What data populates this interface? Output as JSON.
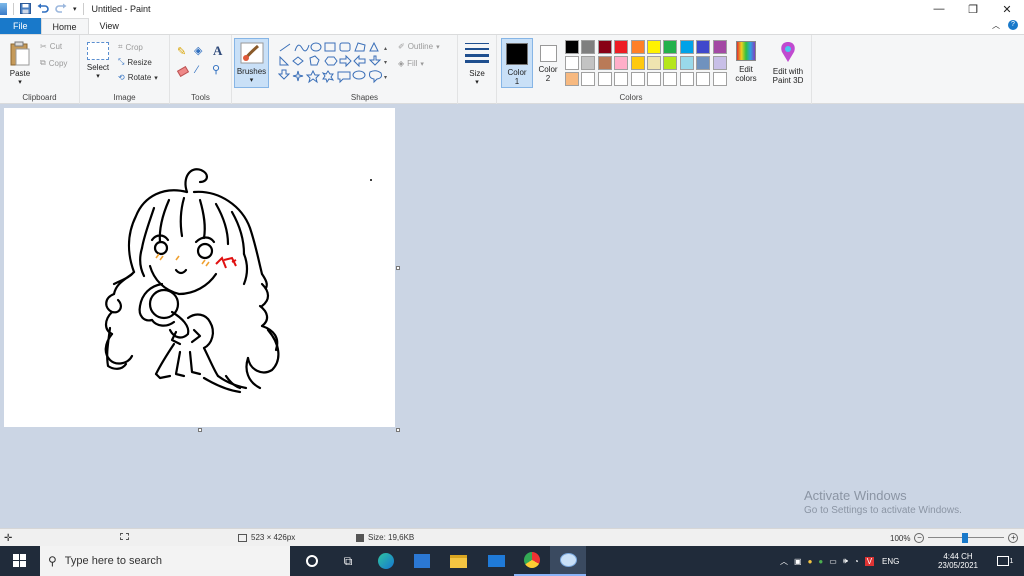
{
  "window": {
    "title": "Untitled - Paint",
    "controls": [
      "minimize",
      "restore",
      "close"
    ]
  },
  "tabs": [
    {
      "label": "File",
      "active": false
    },
    {
      "label": "Home",
      "active": true
    },
    {
      "label": "View",
      "active": false
    }
  ],
  "ribbon": {
    "clipboard": {
      "label": "Clipboard",
      "paste": "Paste",
      "cut": "Cut",
      "copy": "Copy"
    },
    "image": {
      "label": "Image",
      "select": "Select",
      "crop": "Crop",
      "resize": "Resize",
      "rotate": "Rotate"
    },
    "tools": {
      "label": "Tools"
    },
    "brushes": {
      "label": "Brushes"
    },
    "shapes": {
      "label": "Shapes",
      "outline": "Outline",
      "fill": "Fill"
    },
    "size": {
      "label": "Size"
    },
    "colors": {
      "label": "Colors",
      "color1": "Color\n1",
      "color1_a": "Color",
      "color1_b": "1",
      "color2_a": "Color",
      "color2_b": "2",
      "edit_colors_a": "Edit",
      "edit_colors_b": "colors",
      "paint3d_a": "Edit with",
      "paint3d_b": "Paint 3D",
      "color1_value": "#000000",
      "color2_value": "#ffffff",
      "palette_row1": [
        "#000000",
        "#7f7f7f",
        "#880015",
        "#ed1c24",
        "#ff7f27",
        "#fff200",
        "#22b14c",
        "#00a2e8",
        "#3f48cc",
        "#a349a4"
      ],
      "palette_row2": [
        "#ffffff",
        "#c3c3c3",
        "#b97a57",
        "#ffaec9",
        "#ffc90e",
        "#efe4b0",
        "#b5e61d",
        "#99d9ea",
        "#7092be",
        "#c8bfe7"
      ],
      "palette_row3": [
        "#f7b980",
        "#ffffff",
        "#ffffff",
        "#ffffff",
        "#ffffff",
        "#ffffff",
        "#ffffff",
        "#ffffff",
        "#ffffff",
        "#ffffff"
      ]
    }
  },
  "watermark": {
    "line1": "Activate Windows",
    "line2": "Go to Settings to activate Windows."
  },
  "statusbar": {
    "dimensions": "523 × 426px",
    "size": "Size: 19,6KB",
    "zoom": "100%",
    "zoom_value": 100
  },
  "taskbar": {
    "search_placeholder": "Type here to search",
    "language": "ENG",
    "time": "4:44 CH",
    "date": "23/05/2021",
    "notifications": "1"
  }
}
